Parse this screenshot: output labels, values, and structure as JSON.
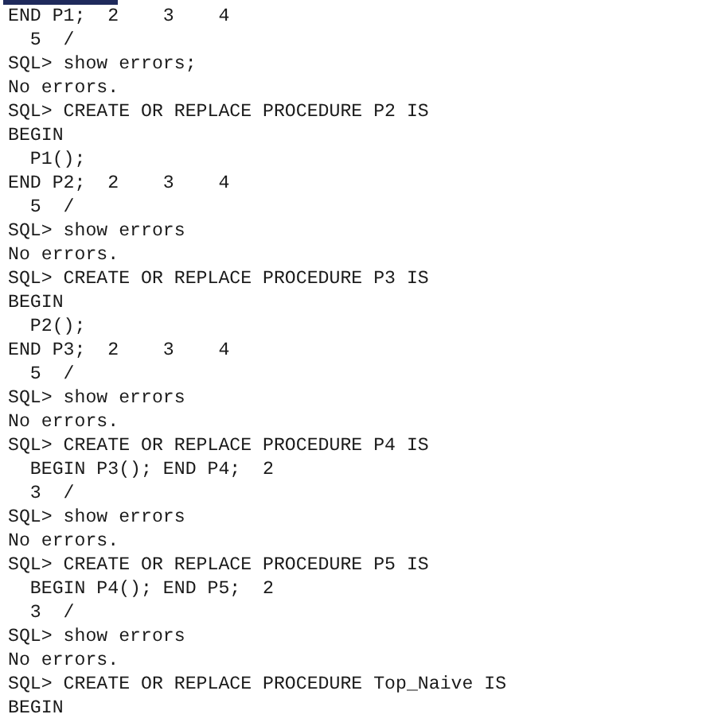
{
  "terminal": {
    "lines": [
      "END P1;  2    3    4",
      "  5  /",
      "SQL> show errors;",
      "No errors.",
      "SQL> CREATE OR REPLACE PROCEDURE P2 IS",
      "BEGIN",
      "  P1();",
      "END P2;  2    3    4",
      "  5  /",
      "SQL> show errors",
      "No errors.",
      "SQL> CREATE OR REPLACE PROCEDURE P3 IS",
      "BEGIN",
      "  P2();",
      "END P3;  2    3    4",
      "  5  /",
      "SQL> show errors",
      "No errors.",
      "SQL> CREATE OR REPLACE PROCEDURE P4 IS",
      "  BEGIN P3(); END P4;  2",
      "  3  /",
      "SQL> show errors",
      "No errors.",
      "SQL> CREATE OR REPLACE PROCEDURE P5 IS",
      "  BEGIN P4(); END P5;  2",
      "  3  /",
      "SQL> show errors",
      "No errors.",
      "SQL> CREATE OR REPLACE PROCEDURE Top_Naive IS",
      "BEGIN"
    ]
  }
}
